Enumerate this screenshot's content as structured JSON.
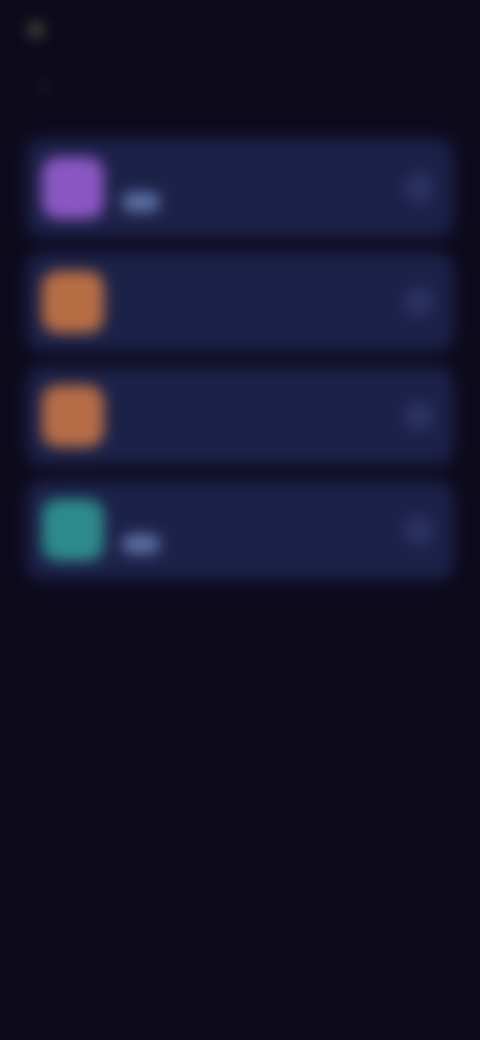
{
  "status": {
    "text": ""
  },
  "header": {
    "title": "",
    "back_icon": "chevron-left-icon"
  },
  "items": [
    {
      "title": "",
      "subtitle": "",
      "has_badge": true,
      "avatar_color": "#8a57c2"
    },
    {
      "title": "",
      "subtitle": "",
      "has_badge": false,
      "avatar_color": "#b86e45"
    },
    {
      "title": "",
      "subtitle": "",
      "has_badge": false,
      "avatar_color": "#b66d47"
    },
    {
      "title": "",
      "subtitle": "",
      "has_badge": true,
      "avatar_color": "#2e8a8a"
    }
  ],
  "footer": {
    "note": ""
  },
  "colors": {
    "background": "#0d0a1c",
    "card": "#1c2148",
    "badge": "#5c6fa3"
  }
}
